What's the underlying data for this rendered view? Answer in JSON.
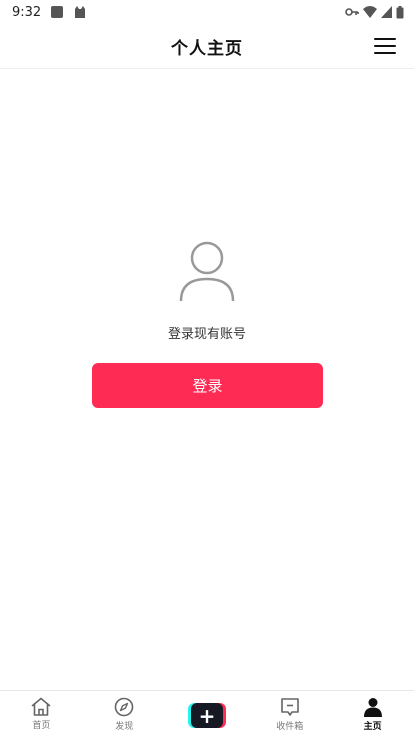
{
  "status_bar": {
    "time": "9:32"
  },
  "header": {
    "title": "个人主页"
  },
  "main": {
    "login_prompt": "登录现有账号",
    "login_button_label": "登录"
  },
  "tab_bar": {
    "items": [
      {
        "label": "首页",
        "icon": "home-icon",
        "active": false
      },
      {
        "label": "发现",
        "icon": "compass-icon",
        "active": false
      },
      {
        "label": "",
        "icon": "plus-icon",
        "active": false
      },
      {
        "label": "收件箱",
        "icon": "inbox-icon",
        "active": false
      },
      {
        "label": "主页",
        "icon": "profile-icon",
        "active": true
      }
    ]
  },
  "colors": {
    "accent": "#fe2c55",
    "create_left": "#25f4ee",
    "create_dark": "#161823"
  }
}
